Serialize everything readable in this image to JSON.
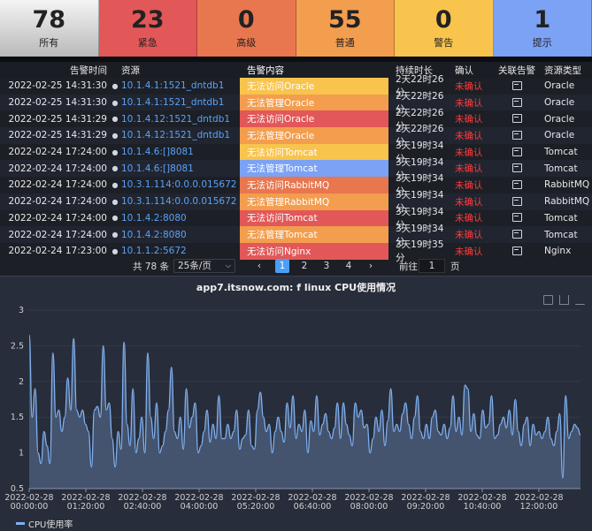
{
  "stats": [
    {
      "num": "78",
      "label": "所有"
    },
    {
      "num": "23",
      "label": "紧急"
    },
    {
      "num": "0",
      "label": "高级"
    },
    {
      "num": "55",
      "label": "普通"
    },
    {
      "num": "0",
      "label": "警告"
    },
    {
      "num": "1",
      "label": "提示"
    }
  ],
  "table": {
    "headers": {
      "time": "告警时间",
      "resource": "资源",
      "content": "告警内容",
      "duration": "持续时长",
      "ack": "确认",
      "related": "关联告警",
      "type": "资源类型"
    },
    "rows": [
      {
        "time": "2022-02-25 14:31:30",
        "resource": "10.1.4.1:1521_dntdb1",
        "content": "无法访问Oracle",
        "duration": "2天22时26分",
        "ack": "未确认",
        "type": "Oracle",
        "color": "#f8c44d"
      },
      {
        "time": "2022-02-25 14:31:30",
        "resource": "10.1.4.1:1521_dntdb1",
        "content": "无法管理Oracle",
        "duration": "2天22时26分",
        "ack": "未确认",
        "type": "Oracle",
        "color": "#f39d4e"
      },
      {
        "time": "2022-02-25 14:31:29",
        "resource": "10.1.4.12:1521_dntdb1",
        "content": "无法访问Oracle",
        "duration": "2天22时26分",
        "ack": "未确认",
        "type": "Oracle",
        "color": "#e25757"
      },
      {
        "time": "2022-02-25 14:31:29",
        "resource": "10.1.4.12:1521_dntdb1",
        "content": "无法管理Oracle",
        "duration": "2天22时26分",
        "ack": "未确认",
        "type": "Oracle",
        "color": "#f39d4e"
      },
      {
        "time": "2022-02-24 17:24:00",
        "resource": "10.1.4.6:[]8081",
        "content": "无法访问Tomcat",
        "duration": "3天19时34分",
        "ack": "未确认",
        "type": "Tomcat",
        "color": "#f8c44d"
      },
      {
        "time": "2022-02-24 17:24:00",
        "resource": "10.1.4.6:[]8081",
        "content": "无法管理Tomcat",
        "duration": "3天19时34分",
        "ack": "未确认",
        "type": "Tomcat",
        "color": "#7ba2f5"
      },
      {
        "time": "2022-02-24 17:24:00",
        "resource": "10.3.1.114:0.0.0.015672",
        "content": "无法访问RabbitMQ",
        "duration": "3天19时34分",
        "ack": "未确认",
        "type": "RabbitMQ",
        "color": "#e8764f"
      },
      {
        "time": "2022-02-24 17:24:00",
        "resource": "10.3.1.114:0.0.0.015672",
        "content": "无法管理RabbitMQ",
        "duration": "3天19时34分",
        "ack": "未确认",
        "type": "RabbitMQ",
        "color": "#f39d4e"
      },
      {
        "time": "2022-02-24 17:24:00",
        "resource": "10.1.4.2:8080",
        "content": "无法访问Tomcat",
        "duration": "3天19时34分",
        "ack": "未确认",
        "type": "Tomcat",
        "color": "#e25757"
      },
      {
        "time": "2022-02-24 17:24:00",
        "resource": "10.1.4.2:8080",
        "content": "无法管理Tomcat",
        "duration": "3天19时34分",
        "ack": "未确认",
        "type": "Tomcat",
        "color": "#f39d4e"
      },
      {
        "time": "2022-02-24 17:23:00",
        "resource": "10.1.1.2:5672",
        "content": "无法访问Nginx",
        "duration": "3天19时35分",
        "ack": "未确认",
        "type": "Nginx",
        "color": "#e25757"
      }
    ]
  },
  "pager": {
    "total": "共 78 条",
    "page_size": "25条/页",
    "pages": [
      "1",
      "2",
      "3",
      "4"
    ],
    "current": "1",
    "goto_label": "前往",
    "goto_value": "1",
    "page_suffix": "页"
  },
  "chart_data": {
    "type": "area",
    "title": "app7.itsnow.com: f linux CPU使用情况",
    "legend": "CPU使用率",
    "ylim": [
      0.5,
      3
    ],
    "yticks": [
      "0.5",
      "1",
      "1.5",
      "2",
      "2.5",
      "3"
    ],
    "xticks": [
      {
        "date": "2022-02-28",
        "time": "00:00:00"
      },
      {
        "date": "2022-02-28",
        "time": "01:20:00"
      },
      {
        "date": "2022-02-28",
        "time": "02:40:00"
      },
      {
        "date": "2022-02-28",
        "time": "04:00:00"
      },
      {
        "date": "2022-02-28",
        "time": "05:20:00"
      },
      {
        "date": "2022-02-28",
        "time": "06:40:00"
      },
      {
        "date": "2022-02-28",
        "time": "08:00:00"
      },
      {
        "date": "2022-02-28",
        "time": "09:20:00"
      },
      {
        "date": "2022-02-28",
        "time": "10:40:00"
      },
      {
        "date": "2022-02-28",
        "time": "12:00:00"
      }
    ],
    "line_color": "#7fb0f0",
    "values": [
      2.65,
      1.5,
      1.9,
      1.0,
      0.85,
      1.3,
      1.1,
      0.85,
      2.4,
      1.5,
      1.6,
      1.3,
      1.5,
      2.05,
      1.6,
      2.6,
      1.6,
      1.5,
      1.6,
      1.4,
      1.3,
      0.8,
      1.6,
      1.65,
      1.5,
      2.5,
      1.6,
      1.7,
      1.2,
      0.8,
      1.3,
      1.05,
      2.55,
      1.4,
      1.1,
      1.9,
      1.0,
      1.2,
      1.5,
      1.0,
      2.4,
      1.5,
      1.2,
      1.7,
      1.0,
      1.1,
      1.3,
      1.6,
      2.2,
      1.3,
      1.2,
      1.5,
      1.05,
      1.9,
      1.35,
      1.5,
      1.7,
      1.0,
      1.1,
      1.3,
      1.6,
      1.15,
      1.4,
      1.2,
      1.8,
      1.2,
      1.2,
      1.4,
      1.2,
      1.3,
      1.6,
      1.05,
      1.2,
      1.25,
      1.6,
      1.1,
      1.05,
      1.6,
      1.85,
      1.5,
      1.3,
      1.4,
      1.0,
      1.3,
      1.5,
      1.3,
      1.15,
      1.7,
      1.35,
      1.8,
      1.2,
      1.4,
      1.3,
      1.6,
      1.0,
      1.45,
      1.3,
      1.8,
      1.25,
      1.4,
      1.55,
      1.3,
      1.2,
      1.35,
      1.7,
      1.2,
      1.7,
      1.4,
      1.25,
      1.1,
      1.7,
      1.5,
      1.6,
      1.35,
      1.4,
      1.0,
      1.2,
      1.5,
      1.3,
      1.6,
      1.1,
      1.45,
      1.9,
      1.3,
      1.4,
      1.3,
      1.55,
      1.7,
      1.4,
      1.2,
      1.5,
      1.8,
      1.3,
      1.2,
      1.4,
      1.2,
      1.5,
      1.6,
      1.3,
      1.25,
      1.4,
      1.2,
      1.35,
      1.8,
      1.3,
      1.5,
      1.25,
      1.95,
      1.9,
      1.3,
      1.55,
      1.25,
      1.2,
      1.6,
      1.35,
      1.4,
      1.8,
      1.2,
      1.25,
      1.4,
      1.5,
      1.35,
      1.6,
      1.25,
      1.75,
      1.3,
      1.1,
      1.4,
      1.5,
      1.1,
      1.4,
      1.25,
      1.3,
      1.2,
      1.3,
      1.5,
      1.2,
      1.1,
      1.3,
      1.55,
      0.65,
      1.8,
      1.2,
      1.3,
      1.4,
      1.35,
      1.25
    ]
  }
}
